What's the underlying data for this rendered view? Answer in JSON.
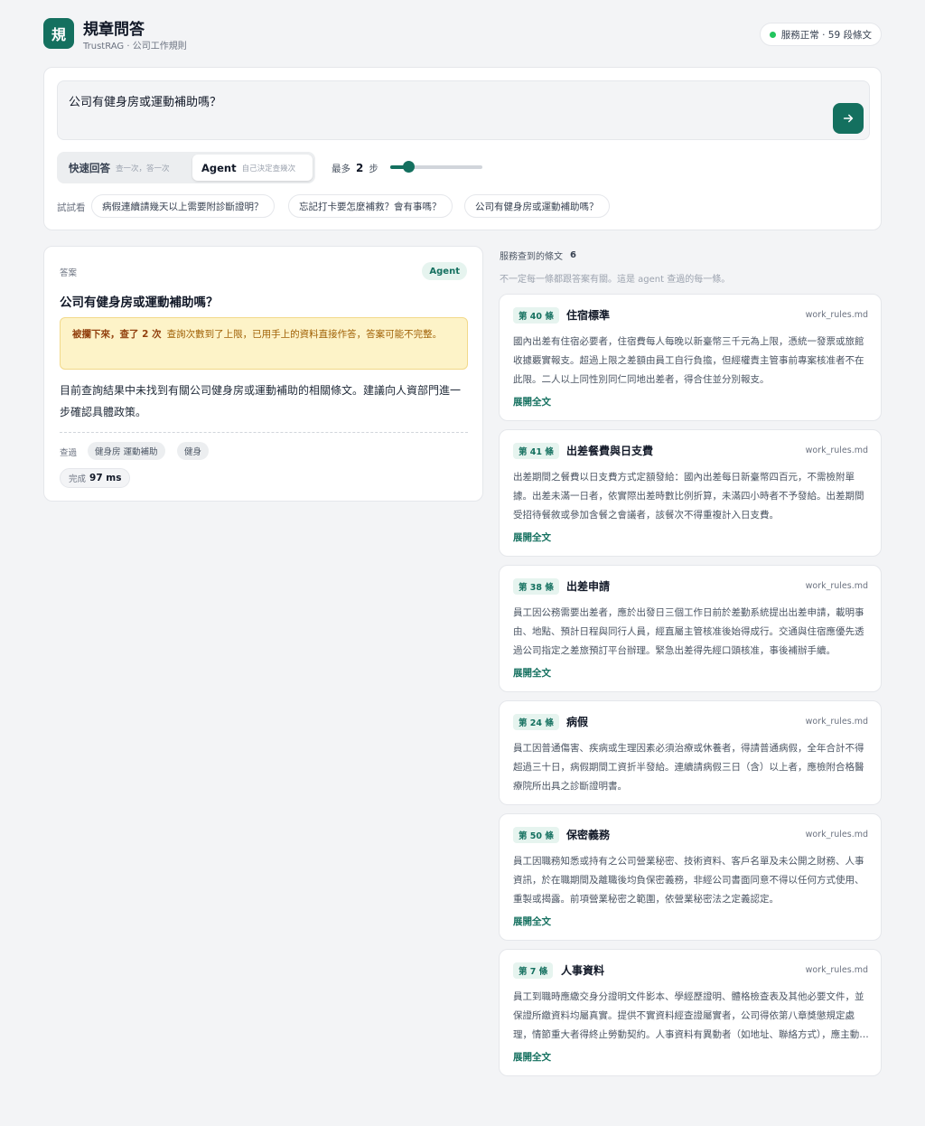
{
  "header": {
    "logo_char": "規",
    "title": "規章問答",
    "subtitle": "TrustRAG · 公司工作規則",
    "status": "服務正常 · 59 段條文"
  },
  "query": {
    "text": "公司有健身房或運動補助嗎？"
  },
  "modes": {
    "quick_label": "快速回答",
    "quick_sub": "查一次，答一次",
    "agent_label": "Agent",
    "agent_sub": "自己決定查幾次",
    "selected": "Agent"
  },
  "steps": {
    "prefix": "最多",
    "value": "2",
    "suffix": "步",
    "slider_level": 0.2
  },
  "suggestions": {
    "label": "試試看",
    "items": [
      "病假連續請幾天以上需要附診斷證明？",
      "忘記打卡要怎麼補救？會有事嗎？",
      "公司有健身房或運動補助嗎？"
    ]
  },
  "answer": {
    "label": "答案",
    "badge": "Agent",
    "question": "公司有健身房或運動補助嗎？",
    "warning_strong": "被攔下來，查了 2 次",
    "warning_text": "查詢次數到了上限，已用手上的資料直接作答，答案可能不完整。",
    "body": "目前查詢結果中未找到有關公司健身房或運動補助的相關條文。建議向人資部門進一步確認具體政策。",
    "searched_label": "查過",
    "searched_terms": [
      "健身房 運動補助",
      "健身"
    ],
    "done_label": "完成",
    "done_ms": "97 ms"
  },
  "sources": {
    "title": "服務查到的條文",
    "count": "6",
    "subtitle": "不一定每一條都跟答案有關。這是 agent 查過的每一條。",
    "expand_label": "展開全文",
    "items": [
      {
        "num": "第 40 條",
        "title": "住宿標準",
        "file": "work_rules.md",
        "text": "國內出差有住宿必要者，住宿費每人每晚以新臺幣三千元為上限，憑統一發票或旅館收據覈實報支。超過上限之差額由員工自行負擔，但經權責主管事前專案核准者不在此限。二人以上同性別同仁同地出差者，得合住並分別報支。"
      },
      {
        "num": "第 41 條",
        "title": "出差餐費與日支費",
        "file": "work_rules.md",
        "text": "出差期間之餐費以日支費方式定額發給：國內出差每日新臺幣四百元，不需檢附單據。出差未滿一日者，依實際出差時數比例折算，未滿四小時者不予發給。出差期間受招待餐敘或參加含餐之會議者，該餐次不得重複計入日支費。"
      },
      {
        "num": "第 38 條",
        "title": "出差申請",
        "file": "work_rules.md",
        "text": "員工因公務需要出差者，應於出發日三個工作日前於差勤系統提出出差申請，載明事由、地點、預計日程與同行人員，經直屬主管核准後始得成行。交通與住宿應優先透過公司指定之差旅預訂平台辦理。緊急出差得先經口頭核准，事後補辦手續。"
      },
      {
        "num": "第 24 條",
        "title": "病假",
        "file": "work_rules.md",
        "text": "員工因普通傷害、疾病或生理因素必須治療或休養者，得請普通病假，全年合計不得超過三十日，病假期間工資折半發給。連續請病假三日（含）以上者，應檢附合格醫療院所出具之診斷證明書。"
      },
      {
        "num": "第 50 條",
        "title": "保密義務",
        "file": "work_rules.md",
        "text": "員工因職務知悉或持有之公司營業秘密、技術資料、客戶名單及未公開之財務、人事資訊，於在職期間及離職後均負保密義務，非經公司書面同意不得以任何方式使用、重製或揭露。前項營業秘密之範圍，依營業秘密法之定義認定。"
      },
      {
        "num": "第 7 條",
        "title": "人事資料",
        "file": "work_rules.md",
        "text": "員工到職時應繳交身分證明文件影本、學經歷證明、體格檢查表及其他必要文件，並保證所繳資料均屬真實。提供不實資料經查證屬實者，公司得依第八章獎懲規定處理，情節重大者得終止勞動契約。人事資料有異動者（如地址、聯絡方式），應主動通知人資部門更新。"
      }
    ]
  }
}
